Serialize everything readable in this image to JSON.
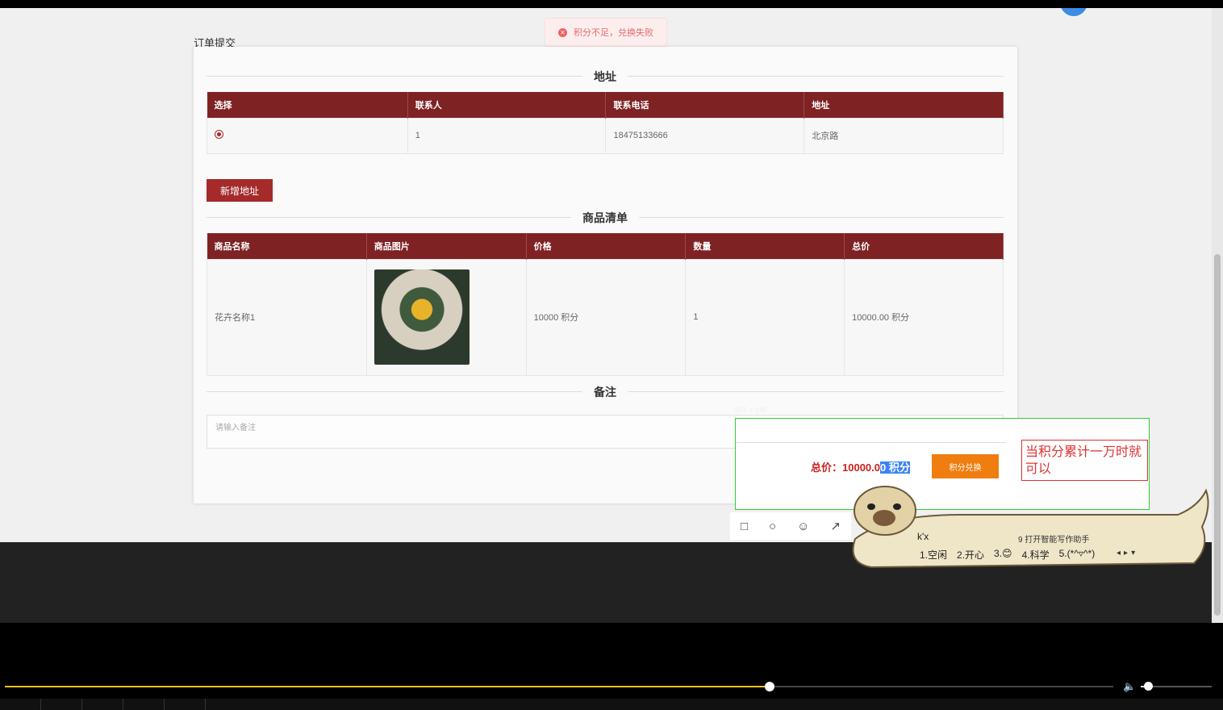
{
  "page": {
    "title": "订单提交",
    "toast_text": "积分不足，兑换失败",
    "toast_icon": "error-icon"
  },
  "address": {
    "section_title": "地址",
    "headers": [
      "选择",
      "联系人",
      "联系电话",
      "地址"
    ],
    "row": {
      "contact": "1",
      "phone": "18475133666",
      "address": "北京路"
    },
    "add_button": "新增地址"
  },
  "goods": {
    "section_title": "商品清单",
    "headers": [
      "商品名称",
      "商品图片",
      "价格",
      "数量",
      "总价"
    ],
    "row": {
      "name": "花卉名称1",
      "price": "10000 积分",
      "qty": "1",
      "total": "10000.00 积分"
    }
  },
  "remark": {
    "section_title": "备注",
    "placeholder": "请输入备注"
  },
  "summary": {
    "label": "总价：",
    "value_prefix": "10000.0",
    "value_selected": "0 积分",
    "redeem_button": "积分兑换"
  },
  "capture": {
    "size_label": "651 x 145",
    "note": "当积分累计一万时就可以"
  },
  "ime": {
    "input": "k'x",
    "tip": "9 打开智能写作助手",
    "candidates": [
      "1.空闲",
      "2.开心",
      "3.😊",
      "4.科学",
      "5.(*^▿^*)"
    ]
  },
  "player": {
    "progress_fraction": 0.69,
    "volume_fraction": 0.1
  },
  "colors": {
    "header_red": "#7e2224",
    "button_red": "#a52a2a",
    "orange": "#f07d10",
    "progress_yellow": "#f2c21b"
  }
}
